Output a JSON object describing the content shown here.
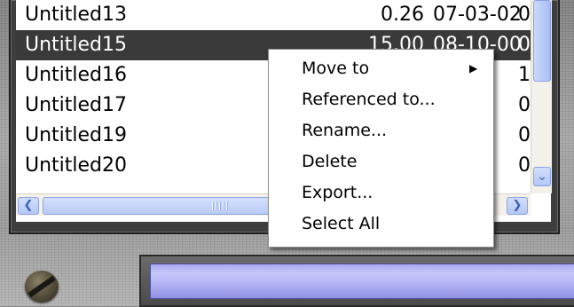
{
  "file_list": {
    "rows": [
      {
        "name": "Untitled13",
        "size": "0.26",
        "date": "07-03-02",
        "flag": "0",
        "selected": false
      },
      {
        "name": "Untitled15",
        "size": "15.00",
        "date": "08-10-00",
        "flag": "0",
        "selected": true
      },
      {
        "name": "Untitled16",
        "size": "",
        "date": "",
        "flag": "1",
        "selected": false
      },
      {
        "name": "Untitled17",
        "size": "",
        "date": "",
        "flag": "0",
        "selected": false
      },
      {
        "name": "Untitled19",
        "size": "",
        "date": "",
        "flag": "0",
        "selected": false
      },
      {
        "name": "Untitled20",
        "size": "",
        "date": "",
        "flag": "0",
        "selected": false
      }
    ]
  },
  "scrollbars": {
    "down_glyph": "⌄",
    "left_glyph": "❮",
    "right_glyph": "❯"
  },
  "context_menu": {
    "items": [
      {
        "label": "Move to",
        "has_submenu": true
      },
      {
        "label": "Referenced to...",
        "has_submenu": false
      },
      {
        "label": "Rename...",
        "has_submenu": false
      },
      {
        "label": "Delete",
        "has_submenu": false
      },
      {
        "label": "Export...",
        "has_submenu": false
      },
      {
        "label": "Select All",
        "has_submenu": false
      }
    ],
    "submenu_arrow": "▶"
  },
  "colors": {
    "selection_bg": "#3a3a3a",
    "status_bar_accent": "#b2b2f4",
    "scrollbar_accent": "#b7c9f7"
  }
}
